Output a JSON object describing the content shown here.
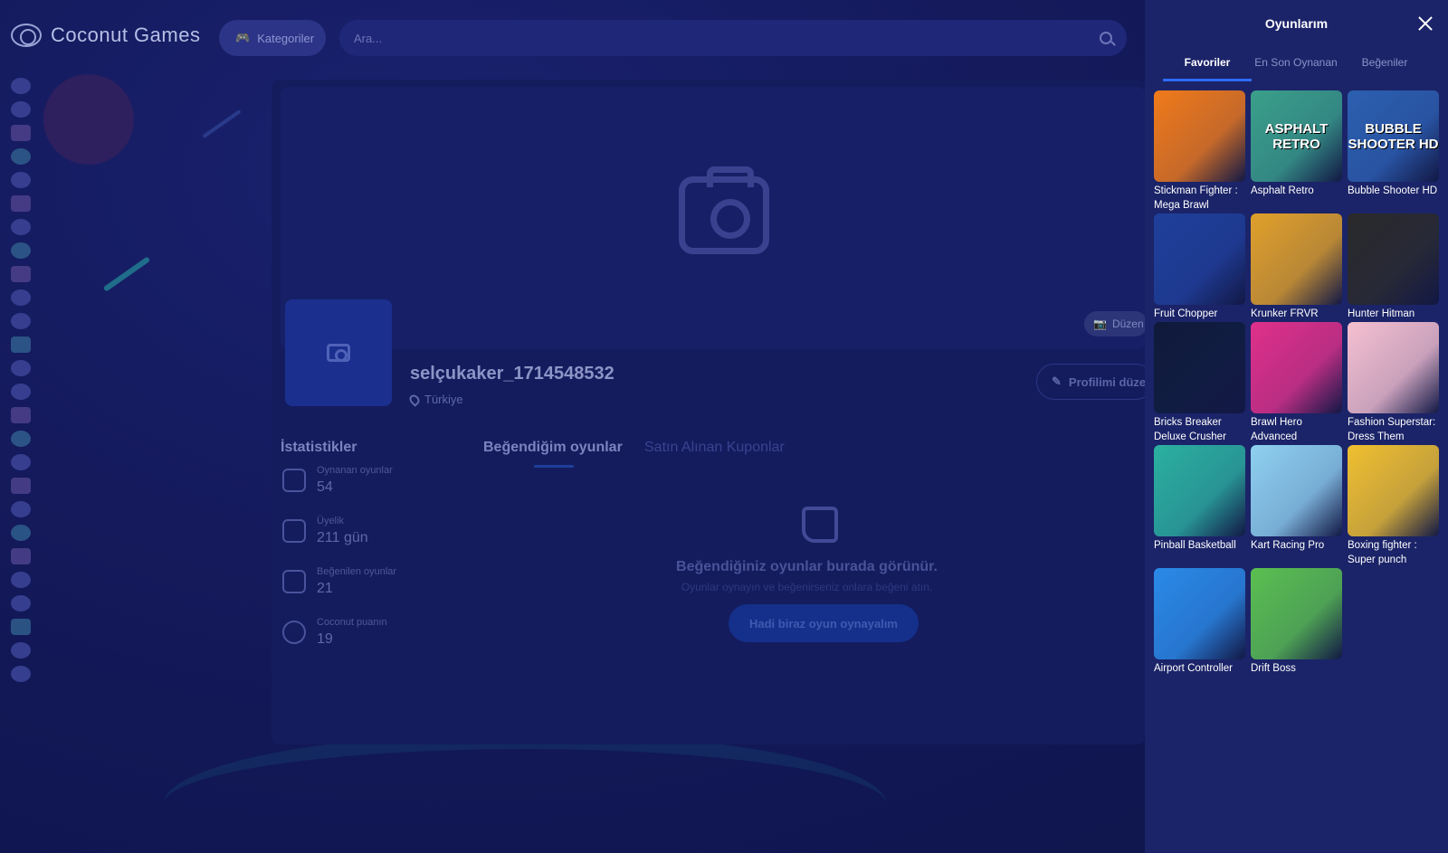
{
  "header": {
    "logo_text": "Coconut Games",
    "categories_label": "Kategoriler",
    "search_placeholder": "Ara..."
  },
  "profile": {
    "username": "selçukaker_1714548532",
    "location": "Türkiye",
    "edit_cover_label": "Düzen",
    "edit_profile_label": "Profilimi düze"
  },
  "stats": {
    "title": "İstatistikler",
    "items": [
      {
        "label": "Oynanan oyunlar",
        "value": "54",
        "icon": "joystick-icon"
      },
      {
        "label": "Üyelik",
        "value": "211 gün",
        "icon": "calendar-icon"
      },
      {
        "label": "Beğenilen oyunlar",
        "value": "21",
        "icon": "thumbs-up-icon"
      },
      {
        "label": "Coconut puanın",
        "value": "19",
        "icon": "coin-icon"
      }
    ]
  },
  "liked": {
    "tab_liked": "Beğendiğim oyunlar",
    "tab_coupons": "Satın Alınan Kuponlar",
    "empty_title": "Beğendiğiniz oyunlar burada görünür.",
    "empty_subtitle": "Oyunlar oynayın ve beğenirseniz onlara beğeni atın.",
    "cta_label": "Hadi biraz oyun oynayalım"
  },
  "drawer": {
    "title": "Oyunlarım",
    "tabs": [
      "Favoriler",
      "En Son Oynanan",
      "Beğeniler"
    ],
    "active_tab": "Favoriler",
    "games": [
      {
        "name": "Stickman Fighter : Mega Brawl",
        "bg": "#f07a1a",
        "art": ""
      },
      {
        "name": "Asphalt Retro",
        "bg": "#3aa08a",
        "art": "ASPHALT RETRO"
      },
      {
        "name": "Bubble Shooter HD",
        "bg": "#2c5fb0",
        "art": "BUBBLE SHOOTER HD"
      },
      {
        "name": "Fruit Chopper",
        "bg": "#1f3f9a",
        "art": ""
      },
      {
        "name": "Krunker FRVR",
        "bg": "#e0a02a",
        "art": ""
      },
      {
        "name": "Hunter Hitman",
        "bg": "#2a2a2a",
        "art": ""
      },
      {
        "name": "Bricks Breaker Deluxe Crusher",
        "bg": "#0f1a3a",
        "art": ""
      },
      {
        "name": "Brawl Hero Advanced",
        "bg": "#e0308a",
        "art": ""
      },
      {
        "name": "Fashion Superstar: Dress Them",
        "bg": "#f5c0d0",
        "art": ""
      },
      {
        "name": "Pinball Basketball",
        "bg": "#2bb0a0",
        "art": ""
      },
      {
        "name": "Kart Racing Pro",
        "bg": "#8fd0f0",
        "art": ""
      },
      {
        "name": "Boxing fighter : Super punch",
        "bg": "#f0c030",
        "art": ""
      },
      {
        "name": "Airport Controller",
        "bg": "#2a8ae8",
        "art": ""
      },
      {
        "name": "Drift Boss",
        "bg": "#5ac050",
        "art": ""
      }
    ]
  },
  "colors": {
    "accent": "#2e6bff",
    "drawer_bg": "#1b2468",
    "page_bg": "#0b1040"
  }
}
